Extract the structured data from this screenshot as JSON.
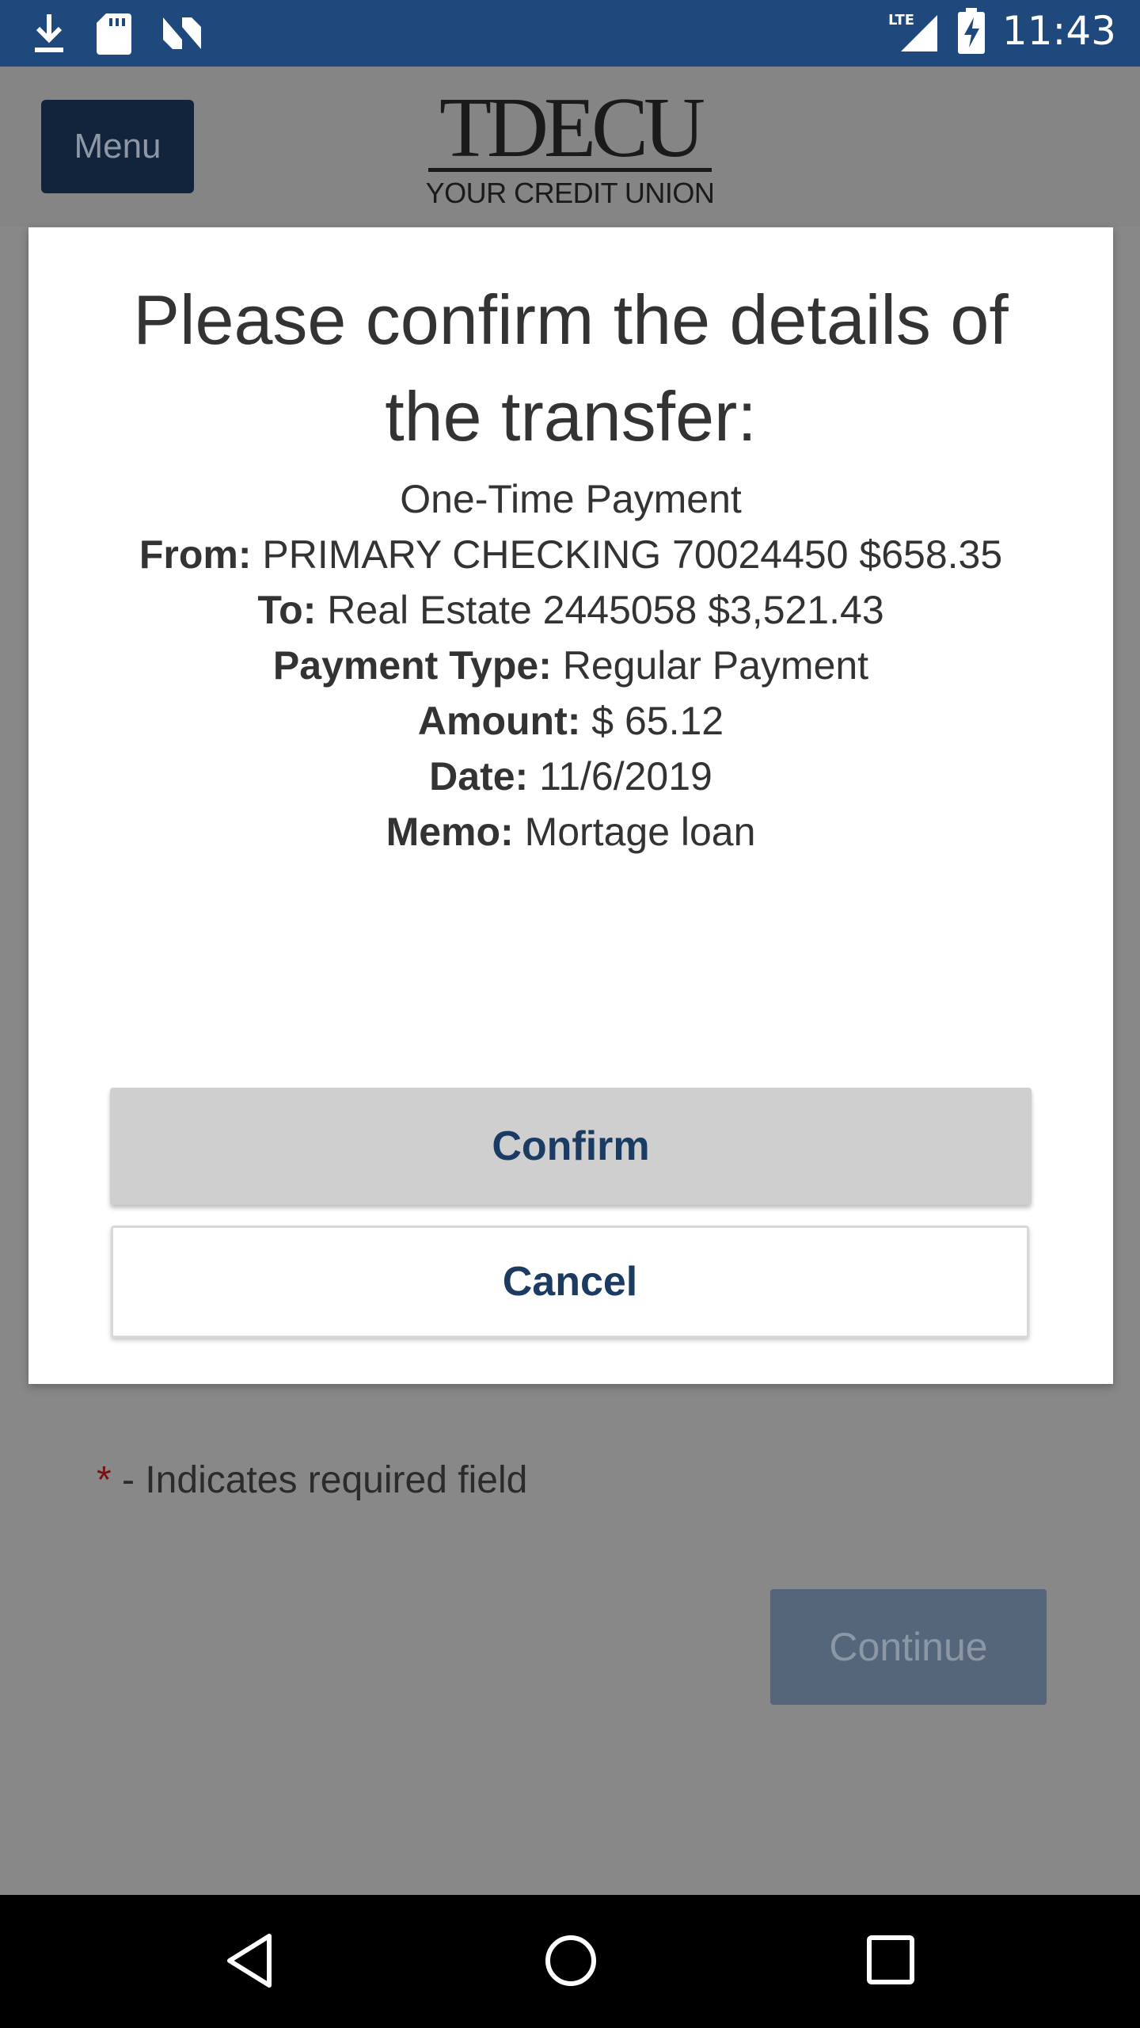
{
  "status_bar": {
    "time": "11:43",
    "network": "LTE",
    "icons": [
      "download-icon",
      "sd-card-icon",
      "n-logo-icon",
      "lte-signal-icon",
      "battery-charging-icon"
    ]
  },
  "header": {
    "menu_label": "Menu",
    "logo_text": "TDECU",
    "logo_subtext": "YOUR CREDIT UNION"
  },
  "dialog": {
    "title": "Please confirm the details of the transfer:",
    "payment_kind": "One-Time Payment",
    "details": [
      {
        "label": "From:",
        "value": "PRIMARY CHECKING 70024450 $658.35"
      },
      {
        "label": "To:",
        "value": "Real Estate 2445058 $3,521.43"
      },
      {
        "label": "Payment Type:",
        "value": "Regular Payment"
      },
      {
        "label": "Amount:",
        "value": "$ 65.12"
      },
      {
        "label": "Date:",
        "value": "11/6/2019"
      },
      {
        "label": "Memo:",
        "value": "Mortage loan"
      }
    ],
    "confirm_label": "Confirm",
    "cancel_label": "Cancel"
  },
  "page": {
    "required_star": "*",
    "required_note": " - Indicates required field",
    "continue_label": "Continue"
  },
  "nav_bar": {
    "icons": [
      "back-icon",
      "home-icon",
      "recents-icon"
    ]
  }
}
